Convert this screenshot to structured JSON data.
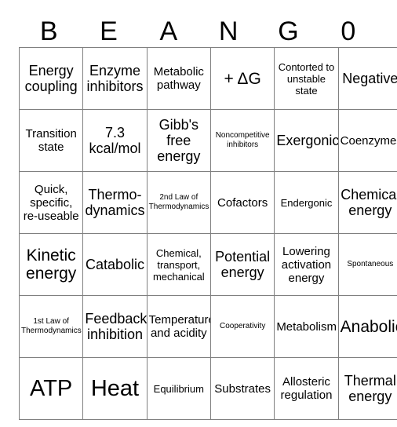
{
  "card": {
    "header": {
      "letters": [
        "B",
        "E",
        "A",
        "N",
        "G",
        "0"
      ]
    },
    "rows": [
      {
        "cells": [
          {
            "text": "Energy coupling",
            "size": "lg"
          },
          {
            "text": "Enzyme inhibitors",
            "size": "lg"
          },
          {
            "text": "Metabolic pathway",
            "size": "md"
          },
          {
            "text": "+ ΔG",
            "size": "xl"
          },
          {
            "text": "Contorted to unstable state",
            "size": "sm"
          },
          {
            "text": "Negative",
            "size": "lg"
          }
        ]
      },
      {
        "cells": [
          {
            "text": "Transition state",
            "size": "md"
          },
          {
            "text": "7.3 kcal/mol",
            "size": "lg"
          },
          {
            "text": "Gibb's free energy",
            "size": "lg"
          },
          {
            "text": "Noncompetitive inhibitors",
            "size": "xs"
          },
          {
            "text": "Exergonic",
            "size": "lg"
          },
          {
            "text": "Coenzymes",
            "size": "md"
          }
        ]
      },
      {
        "cells": [
          {
            "text": "Quick, specific, re-useable",
            "size": "md"
          },
          {
            "text": "Thermo-dynamics",
            "size": "lg"
          },
          {
            "text": "2nd Law of Thermodynamics",
            "size": "xs"
          },
          {
            "text": "Cofactors",
            "size": "md"
          },
          {
            "text": "Endergonic",
            "size": "sm"
          },
          {
            "text": "Chemical energy",
            "size": "lg"
          }
        ]
      },
      {
        "cells": [
          {
            "text": "Kinetic energy",
            "size": "xl"
          },
          {
            "text": "Catabolic",
            "size": "lg"
          },
          {
            "text": "Chemical, transport, mechanical",
            "size": "sm"
          },
          {
            "text": "Potential energy",
            "size": "lg"
          },
          {
            "text": "Lowering activation energy",
            "size": "md"
          },
          {
            "text": "Spontaneous",
            "size": "xs"
          }
        ]
      },
      {
        "cells": [
          {
            "text": "1st Law of Thermodynamics",
            "size": "xs"
          },
          {
            "text": "Feedback inhibition",
            "size": "lg"
          },
          {
            "text": "Temperature and acidity",
            "size": "md"
          },
          {
            "text": "Cooperativity",
            "size": "xs"
          },
          {
            "text": "Metabolism",
            "size": "md"
          },
          {
            "text": "Anabolic",
            "size": "xl"
          }
        ]
      },
      {
        "cells": [
          {
            "text": "ATP",
            "size": "xxl"
          },
          {
            "text": "Heat",
            "size": "xxl"
          },
          {
            "text": "Equilibrium",
            "size": "sm"
          },
          {
            "text": "Substrates",
            "size": "md"
          },
          {
            "text": "Allosteric regulation",
            "size": "md"
          },
          {
            "text": "Thermal energy",
            "size": "lg"
          }
        ]
      }
    ]
  },
  "colors": {
    "grid_line": "#808080",
    "text": "#000000",
    "background": "#ffffff"
  }
}
